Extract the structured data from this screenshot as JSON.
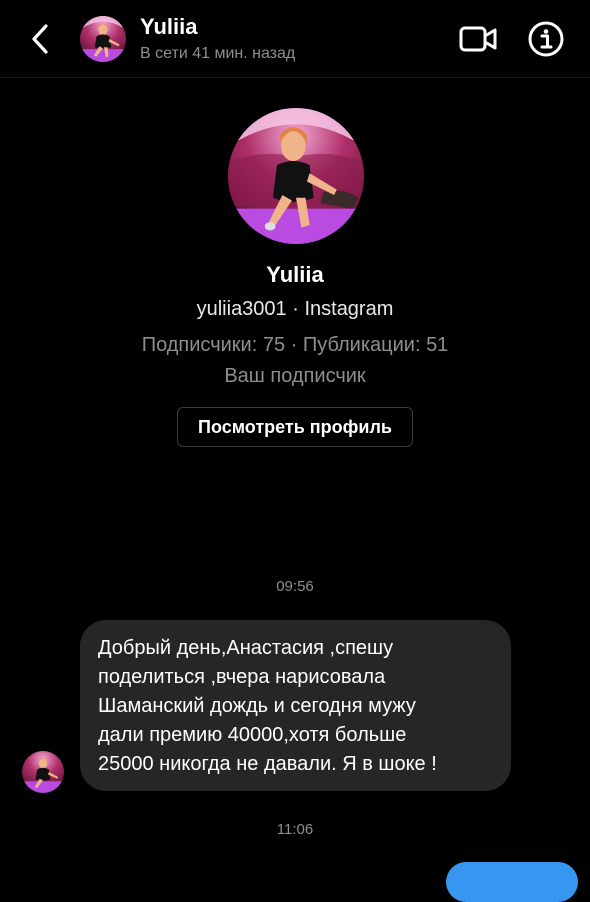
{
  "header": {
    "name": "Yuliia",
    "status": "В сети 41 мин. назад",
    "icons": {
      "back": "chevron-left-icon",
      "video": "video-camera-icon",
      "info": "info-icon"
    }
  },
  "profile": {
    "name": "Yuliia",
    "handle": "yuliia3001 · Instagram",
    "stats": "Подписчики: 75 · Публикации: 51",
    "follow_status": "Ваш подписчик",
    "view_button": "Посмотреть профиль"
  },
  "chat": {
    "time1": "09:56",
    "message_lines": [
      "Добрый день,Анастасия ,спешу",
      "поделиться ,вчера нарисовала",
      "Шаманский дождь и сегодня мужу",
      "дали премию 40000,хотя больше",
      "25000 никогда не давали. Я в шоке !"
    ],
    "time2": "11:06"
  },
  "colors": {
    "background": "#000000",
    "bubble_incoming": "#262626",
    "bubble_outgoing": "#3797f0",
    "secondary_text": "#8e8e93"
  }
}
